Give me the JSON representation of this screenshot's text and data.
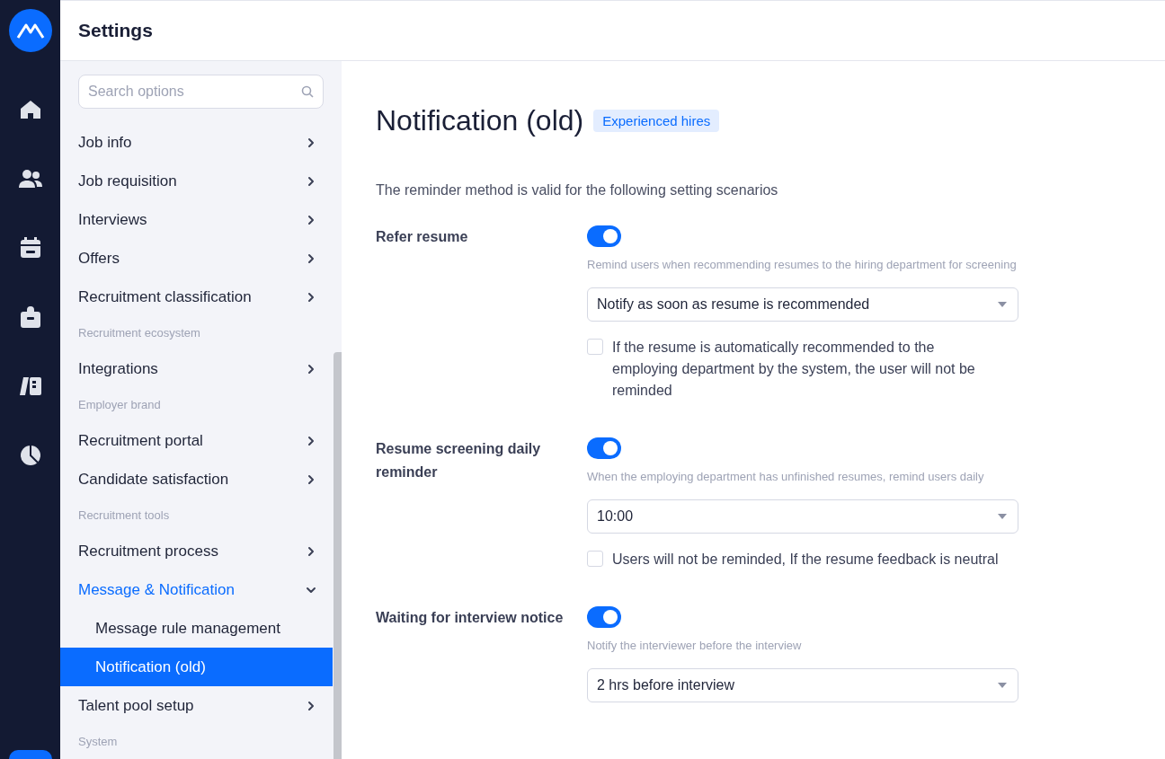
{
  "header": {
    "title": "Settings"
  },
  "rail": {
    "items": [
      {
        "kind": "home",
        "selected": false
      },
      {
        "kind": "people",
        "selected": false
      },
      {
        "kind": "calendar",
        "selected": false
      },
      {
        "kind": "bag",
        "selected": false
      },
      {
        "kind": "book",
        "selected": false
      },
      {
        "kind": "pie",
        "selected": false
      }
    ]
  },
  "sidebar": {
    "search": {
      "placeholder": "Search options"
    },
    "items": [
      {
        "kind": "item",
        "label": "Job info",
        "selected": false
      },
      {
        "kind": "item",
        "label": "Job requisition",
        "selected": false
      },
      {
        "kind": "item",
        "label": "Interviews",
        "selected": false
      },
      {
        "kind": "item",
        "label": "Offers",
        "selected": false
      },
      {
        "kind": "item",
        "label": "Recruitment classification",
        "selected": false
      },
      {
        "kind": "section",
        "label": "Recruitment ecosystem"
      },
      {
        "kind": "item",
        "label": "Integrations",
        "selected": false
      },
      {
        "kind": "section",
        "label": "Employer brand"
      },
      {
        "kind": "item",
        "label": "Recruitment portal",
        "selected": false
      },
      {
        "kind": "item",
        "label": "Candidate satisfaction",
        "selected": false
      },
      {
        "kind": "section",
        "label": "Recruitment tools"
      },
      {
        "kind": "item",
        "label": "Recruitment process",
        "selected": false
      },
      {
        "kind": "item",
        "label": "Message & Notification",
        "selected": false,
        "expanded": true,
        "children": [
          {
            "label": "Message rule management",
            "selected": false
          },
          {
            "label": "Notification (old)",
            "selected": true
          }
        ]
      },
      {
        "kind": "item",
        "label": "Talent pool setup",
        "selected": false
      },
      {
        "kind": "section",
        "label": "System"
      }
    ]
  },
  "main": {
    "title": "Notification (old)",
    "tag": "Experienced hires",
    "intro": "The reminder method is valid for the following setting scenarios",
    "settings": [
      {
        "label": "Refer resume",
        "on": true,
        "hint": "Remind users when recommending resumes to the hiring department for screening",
        "select": "Notify as soon as resume is recommended",
        "checkbox": {
          "label": "If the resume is automatically recommended to the employing department by the system, the user will not be reminded",
          "checked": false
        }
      },
      {
        "label": "Resume screening daily reminder",
        "on": true,
        "hint": "When the employing department has unfinished resumes, remind users daily",
        "select": "10:00",
        "checkbox": {
          "label": "Users will not be reminded, If the resume feedback is neutral",
          "checked": false
        }
      },
      {
        "label": "Waiting for interview notice",
        "on": true,
        "hint": "Notify the interviewer before the interview",
        "select": "2 hrs before interview"
      }
    ]
  }
}
